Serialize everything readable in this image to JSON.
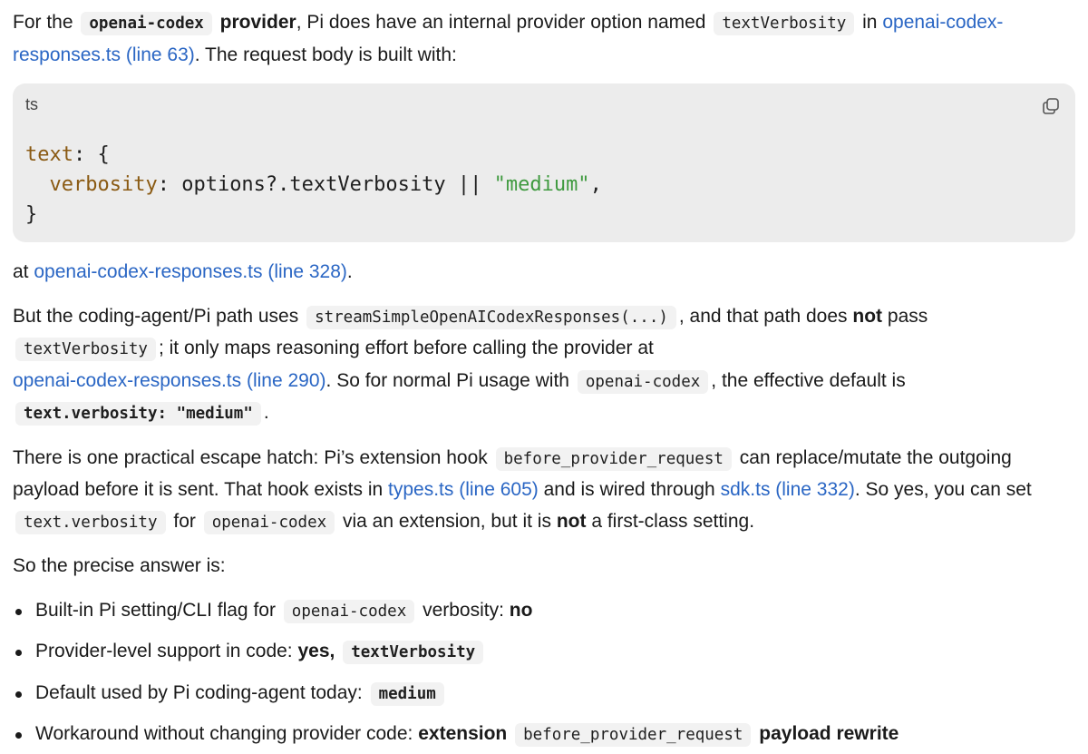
{
  "para1": {
    "t1": "For the",
    "c1": "openai-codex",
    "b1": "provider",
    "t2": ", Pi does have an internal provider option named",
    "c2": "textVerbosity",
    "t3": "in",
    "link1": "openai-codex-responses.ts (line 63)",
    "t4": ". The request body is built with:"
  },
  "codeblock": {
    "language": "ts",
    "line1_key": "text",
    "line1_rest": ": {",
    "line2_key": "verbosity",
    "line2_mid": ": options?.textVerbosity || ",
    "line2_str": "\"medium\"",
    "line2_end": ",",
    "line3": "}",
    "copy_icon": "copy-icon"
  },
  "para2": {
    "t1": "at",
    "link1": "openai-codex-responses.ts (line 328)",
    "t2": "."
  },
  "para3": {
    "t1": "But the coding-agent/Pi path uses",
    "c1": "streamSimpleOpenAICodexResponses(...)",
    "t2": ", and that path does",
    "b1": "not",
    "t3": "pass",
    "c2": "textVerbosity",
    "t4": "; it only maps reasoning effort before calling the provider at",
    "link1": "openai-codex-responses.ts (line 290)",
    "t5": ". So for normal Pi usage with",
    "c3": "openai-codex",
    "t6": ", the effective default is",
    "c4": "text.verbosity: \"medium\"",
    "t7": "."
  },
  "para4": {
    "t1": "There is one practical escape hatch: Pi’s extension hook",
    "c1": "before_provider_request",
    "t2": "can replace/mutate the outgoing payload before it is sent. That hook exists in",
    "link1": "types.ts (line 605)",
    "t3": "and is wired through",
    "link2": "sdk.ts (line 332)",
    "t4": ". So yes, you can set",
    "c2": "text.verbosity",
    "t5": "for",
    "c3": "openai-codex",
    "t6": "via an extension, but it is",
    "b1": "not",
    "t7": "a first-class setting."
  },
  "para5": {
    "t1": "So the precise answer is:"
  },
  "bullets": {
    "b1": {
      "t1": "Built-in Pi setting/CLI flag for",
      "c1": "openai-codex",
      "t2": "verbosity:",
      "bold": "no"
    },
    "b2": {
      "t1": "Provider-level support in code:",
      "bold": "yes,",
      "c1": "textVerbosity"
    },
    "b3": {
      "t1": "Default used by Pi coding-agent today:",
      "c1": "medium"
    },
    "b4": {
      "t1": "Workaround without changing provider code:",
      "bold1": "extension",
      "c1": "before_provider_request",
      "bold2": "payload rewrite"
    }
  }
}
